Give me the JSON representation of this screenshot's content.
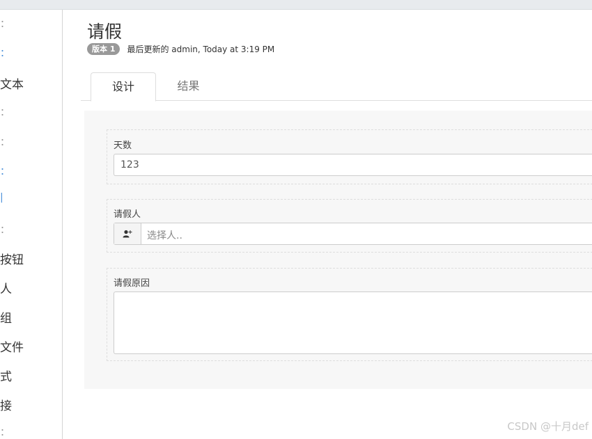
{
  "sidebar": {
    "fragments": [
      {
        "text": "：",
        "blue": false
      },
      {
        "text": "：",
        "blue": true
      },
      {
        "text": "：",
        "blue": false
      },
      {
        "text": "：",
        "blue": false
      },
      {
        "text": "：",
        "blue": true
      },
      {
        "text": "|",
        "blue": true
      },
      {
        "text": "：",
        "blue": false
      },
      {
        "text": "：",
        "blue": false
      }
    ],
    "items": [
      "文本",
      "按钮",
      "人",
      "组",
      "文件",
      "式",
      "接"
    ]
  },
  "header": {
    "title": "请假",
    "version_badge": "版本 1",
    "updated_text": "最后更新的 admin, Today at 3:19 PM"
  },
  "tabs": [
    {
      "label": "设计",
      "active": true
    },
    {
      "label": "结果",
      "active": false
    }
  ],
  "form": {
    "days": {
      "label": "天数",
      "value": "123"
    },
    "person": {
      "label": "请假人",
      "placeholder": "选择人..",
      "icon": "add-user-icon"
    },
    "reason": {
      "label": "请假原因",
      "value": ""
    }
  },
  "watermark": "CSDN @十月def"
}
